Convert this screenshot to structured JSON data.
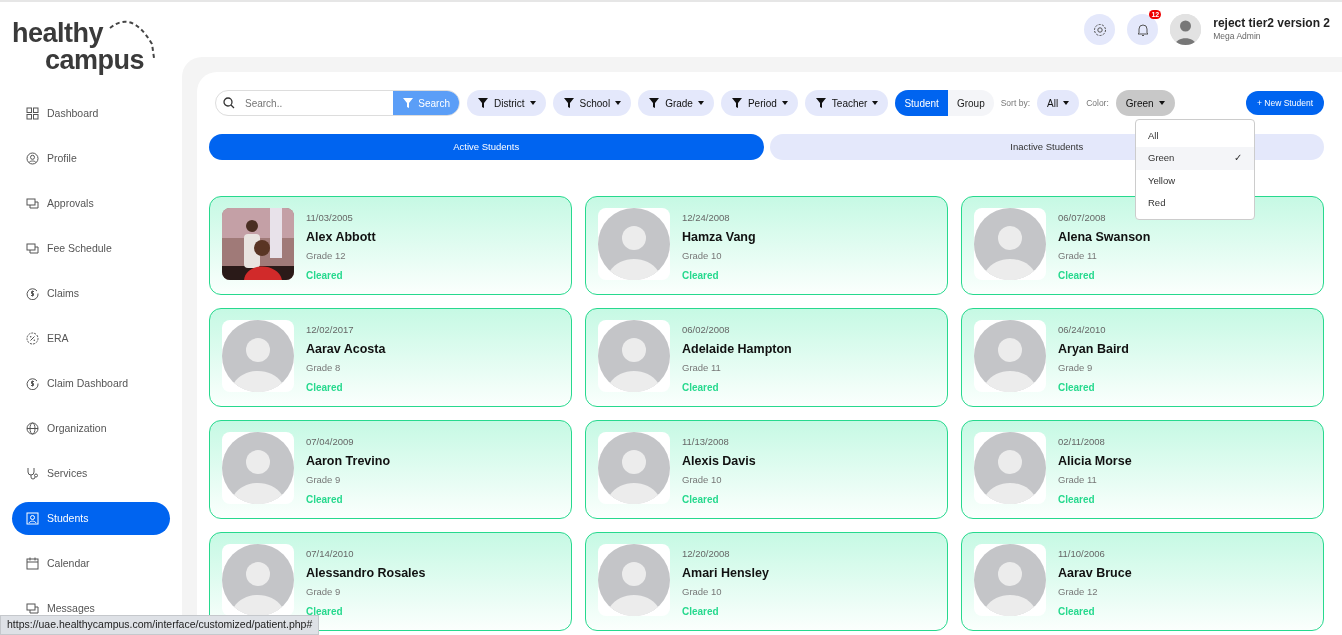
{
  "logo": {
    "line_1": "healthy",
    "line_2": "campus"
  },
  "sidebar": {
    "items": [
      {
        "label": "Dashboard",
        "selected": false
      },
      {
        "label": "Profile",
        "selected": false
      },
      {
        "label": "Approvals",
        "selected": false
      },
      {
        "label": "Fee Schedule",
        "selected": false
      },
      {
        "label": "Claims",
        "selected": false
      },
      {
        "label": "ERA",
        "selected": false
      },
      {
        "label": "Claim Dashboard",
        "selected": false
      },
      {
        "label": "Organization",
        "selected": false
      },
      {
        "label": "Services",
        "selected": false
      },
      {
        "label": "Students",
        "selected": true
      },
      {
        "label": "Calendar",
        "selected": false
      },
      {
        "label": "Messages",
        "selected": false
      }
    ]
  },
  "header": {
    "notification_count": "12",
    "user_name": "reject tier2 version 2",
    "user_role": "Mega Admin"
  },
  "toolbar": {
    "search": {
      "placeholder": "Search..",
      "button": "Search"
    },
    "filters": [
      "District",
      "School",
      "Grade",
      "Period",
      "Teacher"
    ],
    "view_toggle": [
      {
        "label": "Student",
        "selected": true
      },
      {
        "label": "Group",
        "selected": false
      }
    ],
    "sort_label": "Sort by:",
    "sort_value": "All",
    "color_label": "Color:",
    "color_value": "Green",
    "new_button": "+ New Student"
  },
  "color_menu": [
    {
      "label": "All",
      "selected": false
    },
    {
      "label": "Green",
      "selected": true
    },
    {
      "label": "Yellow",
      "selected": false
    },
    {
      "label": "Red",
      "selected": false
    }
  ],
  "check_mark": "✓",
  "tabs": [
    {
      "label": "Active Students",
      "selected": true
    },
    {
      "label": "Inactive Students",
      "selected": false
    }
  ],
  "students": [
    {
      "date": "11/03/2005",
      "name": "Alex Abbott",
      "grade": "Grade 12",
      "status": "Cleared",
      "kind": "picture"
    },
    {
      "date": "12/24/2008",
      "name": "Hamza Vang",
      "grade": "Grade 10",
      "status": "Cleared",
      "kind": "placeholder"
    },
    {
      "date": "06/07/2008",
      "name": "Alena Swanson",
      "grade": "Grade 11",
      "status": "Cleared",
      "kind": "placeholder"
    },
    {
      "date": "12/02/2017",
      "name": "Aarav Acosta",
      "grade": "Grade 8",
      "status": "Cleared",
      "kind": "placeholder"
    },
    {
      "date": "06/02/2008",
      "name": "Adelaide Hampton",
      "grade": "Grade 11",
      "status": "Cleared",
      "kind": "placeholder"
    },
    {
      "date": "06/24/2010",
      "name": "Aryan Baird",
      "grade": "Grade 9",
      "status": "Cleared",
      "kind": "placeholder"
    },
    {
      "date": "07/04/2009",
      "name": "Aaron Trevino",
      "grade": "Grade 9",
      "status": "Cleared",
      "kind": "placeholder"
    },
    {
      "date": "11/13/2008",
      "name": "Alexis Davis",
      "grade": "Grade 10",
      "status": "Cleared",
      "kind": "placeholder"
    },
    {
      "date": "02/11/2008",
      "name": "Alicia Morse",
      "grade": "Grade 11",
      "status": "Cleared",
      "kind": "placeholder"
    },
    {
      "date": "07/14/2010",
      "name": "Alessandro Rosales",
      "grade": "Grade 9",
      "status": "Cleared",
      "kind": "placeholder"
    },
    {
      "date": "12/20/2008",
      "name": "Amari Hensley",
      "grade": "Grade 10",
      "status": "Cleared",
      "kind": "placeholder"
    },
    {
      "date": "11/10/2006",
      "name": "Aarav Bruce",
      "grade": "Grade 12",
      "status": "Cleared",
      "kind": "placeholder"
    }
  ],
  "status_bar": "https://uae.healthycampus.com/interface/customized/patient.php#"
}
